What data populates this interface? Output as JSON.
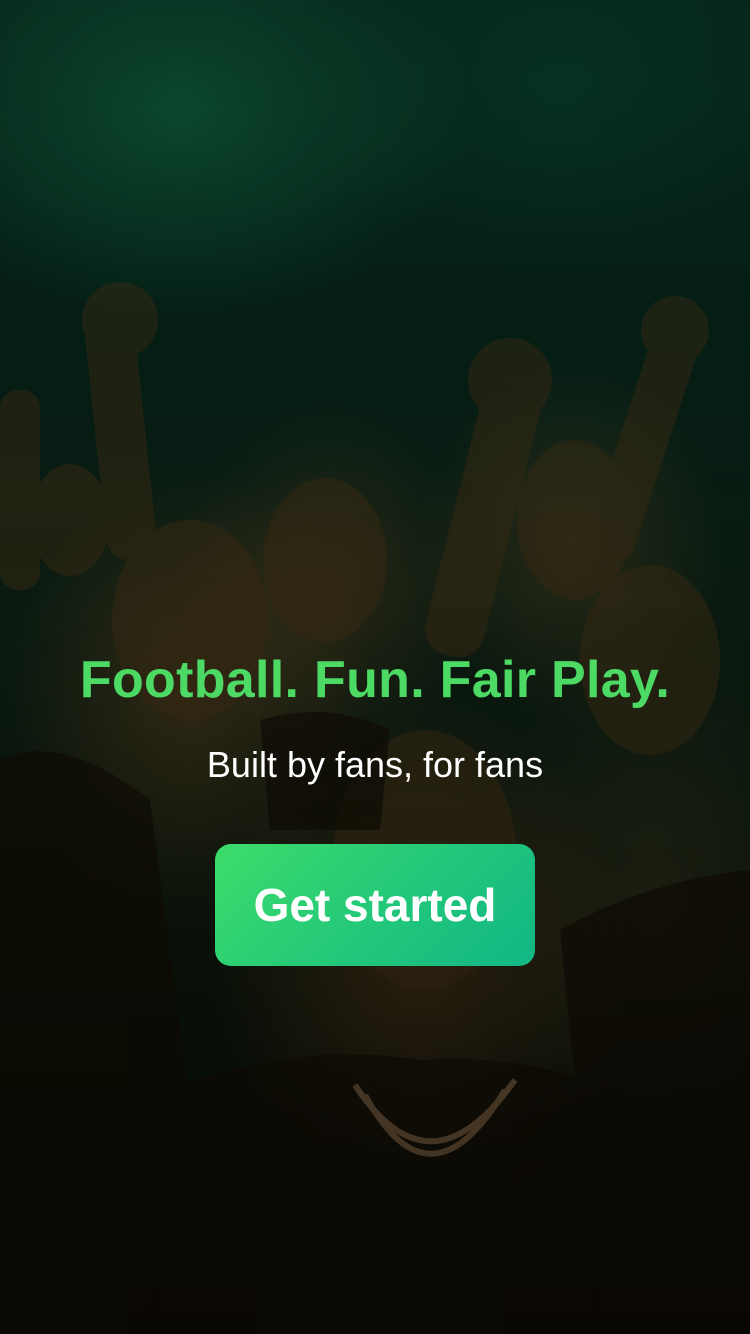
{
  "hero": {
    "headline": "Football. Fun. Fair Play.",
    "subheadline": "Built by fans, for fans"
  },
  "cta": {
    "label": "Get started"
  },
  "colors": {
    "headline": "#4cd964",
    "button_start": "#3ddc6a",
    "button_end": "#12b785",
    "text": "#ffffff"
  }
}
